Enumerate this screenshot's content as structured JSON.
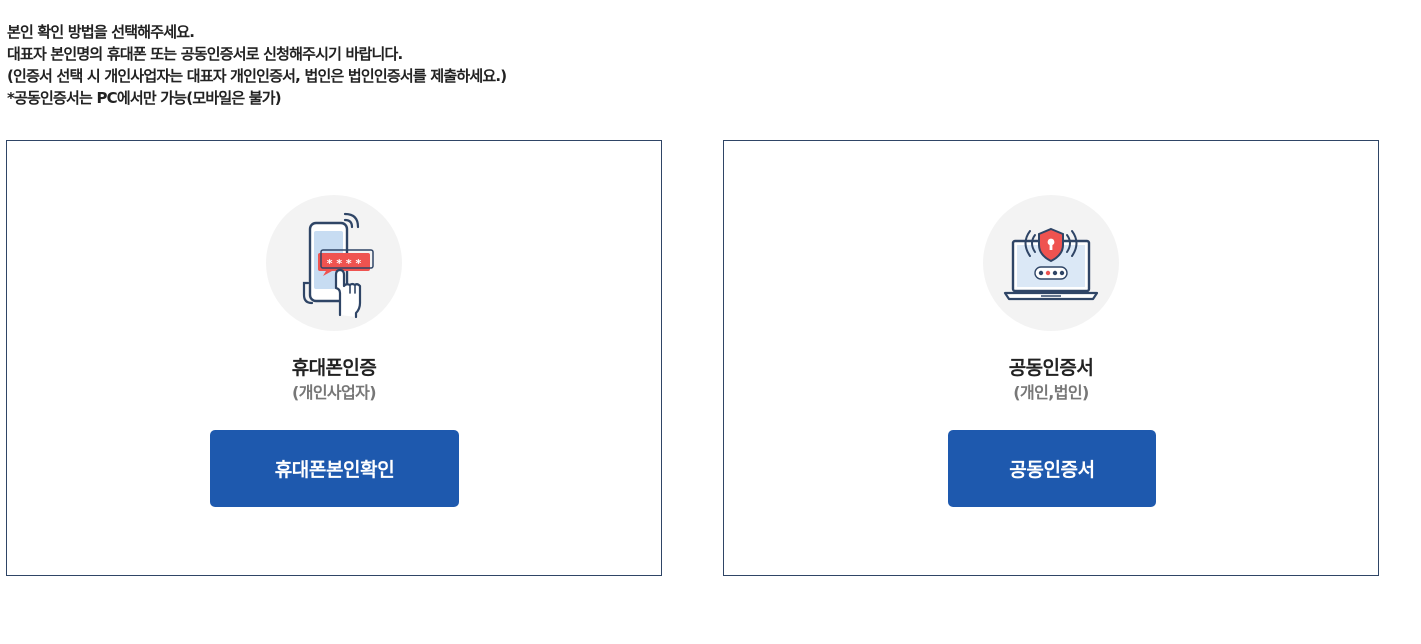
{
  "instructions": [
    "본인 확인 방법을 선택해주세요.",
    "대표자 본인명의 휴대폰 또는 공동인증서로 신청해주시기 바랍니다.",
    "(인증서 선택 시 개인사업자는 대표자 개인인증서, 법인은 법인인증서를 제출하세요.)",
    "*공동인증서는 PC에서만 가능(모바일은 불가)"
  ],
  "options": [
    {
      "icon": "phone-touch-icon",
      "title": "휴대폰인증",
      "subtitle": "(개인사업자)",
      "button_label": "휴대폰본인확인"
    },
    {
      "icon": "laptop-shield-icon",
      "title": "공동인증서",
      "subtitle": "(개인,법인)",
      "button_label": "공동인증서"
    }
  ],
  "colors": {
    "button_bg": "#1e59ae",
    "card_border": "#2f4566",
    "icon_bg": "#f3f3f3",
    "accent_red": "#ef5350",
    "text_dark": "#222222",
    "text_gray": "#777777"
  }
}
